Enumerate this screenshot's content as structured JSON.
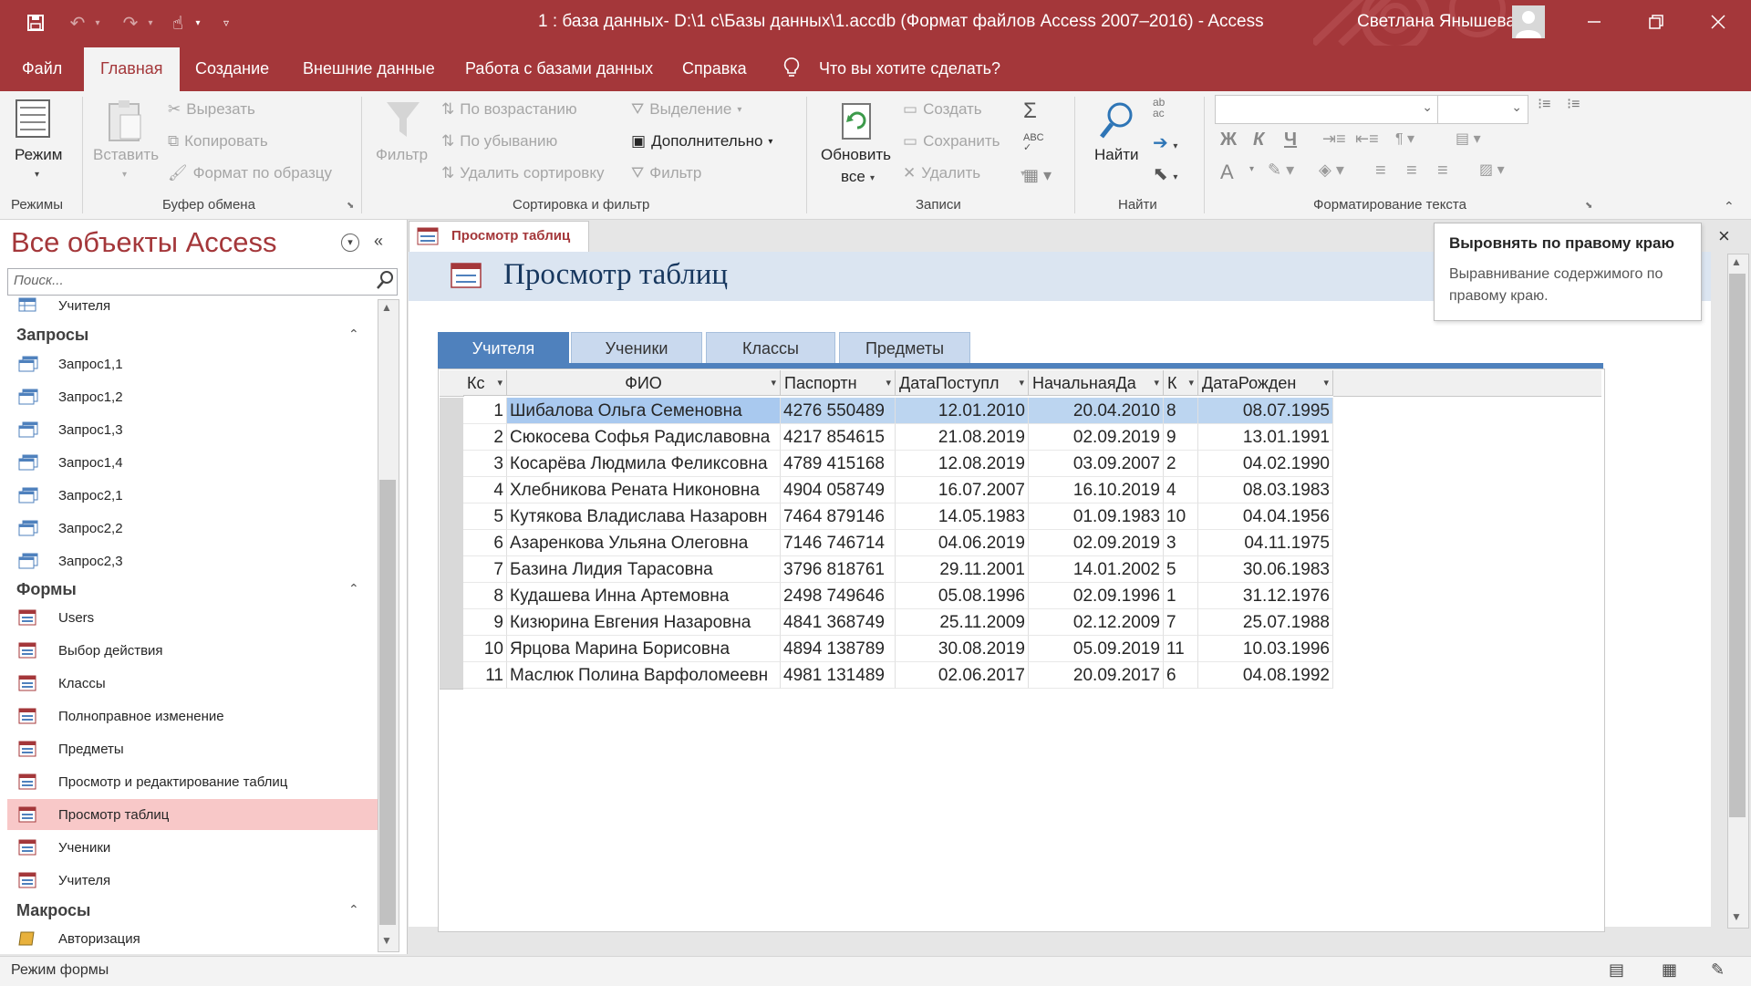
{
  "window": {
    "title": "1 : база данных- D:\\1 с\\Базы данных\\1.accdb (Формат файлов Access 2007–2016)  -  Access",
    "user": "Светлана Янышева"
  },
  "ribbon_tabs": [
    "Файл",
    "Главная",
    "Создание",
    "Внешние данные",
    "Работа с базами данных",
    "Справка",
    "Что вы хотите сделать?"
  ],
  "ribbon": {
    "modes": {
      "view": "Режим",
      "group": "Режимы"
    },
    "clipboard": {
      "paste": "Вставить",
      "cut": "Вырезать",
      "copy": "Копировать",
      "format_painter": "Формат по образцу",
      "group": "Буфер обмена"
    },
    "sort_filter": {
      "filter": "Фильтр",
      "ascending": "По возрастанию",
      "descending": "По убыванию",
      "remove_sort": "Удалить сортировку",
      "selection": "Выделение",
      "advanced": "Дополнительно",
      "toggle_filter": "Фильтр",
      "group": "Сортировка и фильтр"
    },
    "records": {
      "refresh": "Обновить",
      "refresh_all": "все",
      "new": "Создать",
      "save": "Сохранить",
      "delete": "Удалить",
      "group": "Записи"
    },
    "find": {
      "find": "Найти",
      "group": "Найти"
    },
    "text_format": {
      "bold": "Ж",
      "italic": "К",
      "underline": "Ч",
      "font_color": "A",
      "group": "Форматирование текста"
    }
  },
  "nav": {
    "title": "Все объекты Access",
    "search_placeholder": "Поиск...",
    "top_item": "Учителя",
    "queries_label": "Запросы",
    "queries": [
      "Запрос1,1",
      "Запрос1,2",
      "Запрос1,3",
      "Запрос1,4",
      "Запрос2,1",
      "Запрос2,2",
      "Запрос2,3"
    ],
    "forms_label": "Формы",
    "forms": [
      "Users",
      "Выбор действия",
      "Классы",
      "Полноправное изменение",
      "Предметы",
      "Просмотр и редактирование таблиц",
      "Просмотр таблиц",
      "Ученики",
      "Учителя"
    ],
    "selected_form_index": 6,
    "macros_label": "Макросы",
    "macros": [
      "Авторизация"
    ]
  },
  "document": {
    "tab_label": "Просмотр таблиц",
    "form_title": "Просмотр таблиц",
    "form_tabs": [
      "Учителя",
      "Ученики",
      "Классы",
      "Предметы"
    ],
    "active_tab_index": 0
  },
  "table": {
    "columns": [
      "Кс",
      "ФИО",
      "Паспортн",
      "ДатаПоступл",
      "НачальнаяДа",
      "К",
      "ДатаРожден"
    ],
    "rows": [
      [
        "1",
        "Шибалова Ольга Семеновна",
        "4276 550489",
        "12.01.2010",
        "20.04.2010",
        "8",
        "08.07.1995"
      ],
      [
        "2",
        "Сюкосева Софья Радиславовна",
        "4217 854615",
        "21.08.2019",
        "02.09.2019",
        "9",
        "13.01.1991"
      ],
      [
        "3",
        "Косарёва Людмила Феликсовна",
        "4789 415168",
        "12.08.2019",
        "03.09.2007",
        "2",
        "04.02.1990"
      ],
      [
        "4",
        "Хлебникова Рената Никоновна",
        "4904 058749",
        "16.07.2007",
        "16.10.2019",
        "4",
        "08.03.1983"
      ],
      [
        "5",
        "Кутякова Владислава Назаровн",
        "7464 879146",
        "14.05.1983",
        "01.09.1983",
        "10",
        "04.04.1956"
      ],
      [
        "6",
        "Азаренкова Ульяна Олеговна",
        "7146 746714",
        "04.06.2019",
        "02.09.2019",
        "3",
        "04.11.1975"
      ],
      [
        "7",
        "Базина Лидия Тарасовна",
        "3796 818761",
        "29.11.2001",
        "14.01.2002",
        "5",
        "30.06.1983"
      ],
      [
        "8",
        "Кудашева Инна Артемовна",
        "2498 749646",
        "05.08.1996",
        "02.09.1996",
        "1",
        "31.12.1976"
      ],
      [
        "9",
        "Кизюрина Евгения Назаровна",
        "4841 368749",
        "25.11.2009",
        "02.12.2009",
        "7",
        "25.07.1988"
      ],
      [
        "10",
        "Ярцова Марина Борисовна",
        "4894 138789",
        "30.08.2019",
        "05.09.2019",
        "11",
        "10.03.1996"
      ],
      [
        "11",
        "Маслюк Полина Варфоломеевн",
        "4981 131489",
        "02.06.2017",
        "20.09.2017",
        "6",
        "04.08.1992"
      ]
    ],
    "selected_row_index": 0
  },
  "tooltip": {
    "title": "Выровнять по правому краю",
    "body": "Выравнивание содержимого по правому краю."
  },
  "status": {
    "text": "Режим формы"
  },
  "colors": {
    "accent": "#a4373a",
    "form_tab_active": "#4f81bd",
    "nav_selected": "#f8c8c8"
  }
}
